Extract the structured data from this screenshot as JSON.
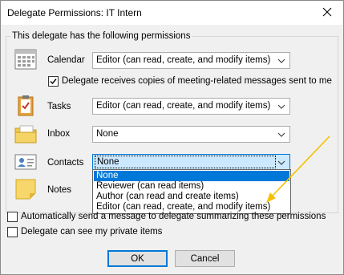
{
  "window": {
    "title": "Delegate Permissions: IT Intern"
  },
  "group": {
    "title": "This delegate has the following permissions"
  },
  "rows": {
    "calendar": {
      "label": "Calendar",
      "value": "Editor (can read, create, and modify items)"
    },
    "tasks": {
      "label": "Tasks",
      "value": "Editor (can read, create, and modify items)"
    },
    "inbox": {
      "label": "Inbox",
      "value": "None"
    },
    "contacts": {
      "label": "Contacts",
      "value": "None"
    },
    "notes": {
      "label": "Notes"
    }
  },
  "meeting_copies": {
    "label": "Delegate receives copies of meeting-related messages sent to me",
    "checked": true
  },
  "dropdown": {
    "options": [
      "None",
      "Reviewer (can read items)",
      "Author (can read and create items)",
      "Editor (can read, create, and modify items)"
    ],
    "selected_index": 0
  },
  "options": {
    "auto_send": {
      "label": "Automatically send a message to delegate summarizing these permissions",
      "checked": false
    },
    "private_items": {
      "label": "Delegate can see my private items",
      "checked": false
    }
  },
  "buttons": {
    "ok": "OK",
    "cancel": "Cancel"
  },
  "colors": {
    "accent": "#0078d7",
    "annotation_arrow": "#f5c000"
  },
  "icons": {
    "close": "close-icon",
    "calendar": "calendar-icon",
    "tasks": "tasks-clipboard-icon",
    "inbox": "inbox-folder-icon",
    "contacts": "contact-card-icon",
    "notes": "sticky-note-icon"
  }
}
